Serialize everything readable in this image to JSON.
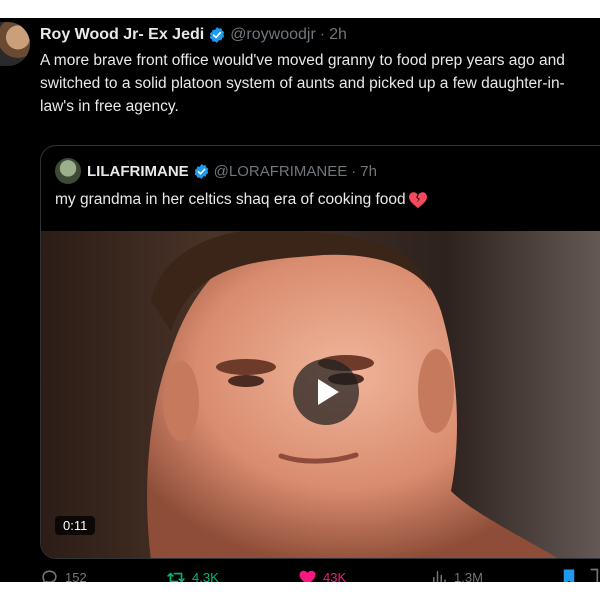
{
  "tweet": {
    "author_name": "Roy Wood Jr- Ex Jedi",
    "handle": "@roywoodjr",
    "separator": "·",
    "time": "2h",
    "text": "A more brave front office would've moved granny to food prep years ago and switched to a solid platoon system of aunts and picked up a few daughter-in-law's in free agency."
  },
  "quote": {
    "author_name": "LILAFRIMANE",
    "handle": "@LORAFRIMANEE",
    "separator": "·",
    "time": "7h",
    "text": "my grandma in her celtics shaq era of cooking food",
    "media": {
      "duration": "0:11",
      "play_icon": "play-icon"
    }
  },
  "actions": {
    "replies": "152",
    "retweets": "4.3K",
    "likes": "43K",
    "views": "1.3M"
  },
  "colors": {
    "background": "#000000",
    "text": "#e7e9ea",
    "muted": "#71767b",
    "verified": "#1d9bf0",
    "retweet": "#00ba7c",
    "like": "#f91880",
    "bookmark": "#1d9bf0"
  },
  "icons": [
    "verified-badge-icon",
    "reply-icon",
    "retweet-icon",
    "heart-icon",
    "views-icon",
    "bookmark-icon",
    "share-icon",
    "broken-heart-emoji-icon"
  ]
}
